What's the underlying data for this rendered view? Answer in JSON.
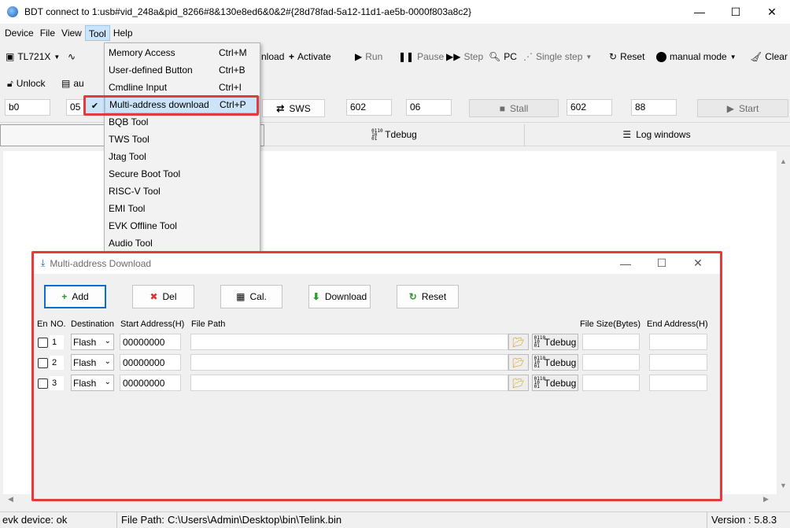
{
  "window": {
    "title": "BDT connect to 1:usb#vid_248a&pid_8266#8&130e8ed6&0&2#{28d78fad-5a12-11d1-ae5b-0000f803a8c2}",
    "controls": [
      "—",
      "☐",
      "✕"
    ]
  },
  "menubar": [
    "Device",
    "File",
    "View",
    "Tool",
    "Help"
  ],
  "toolbar1": {
    "chip": "TL721X",
    "download": "nload",
    "activate": "Activate",
    "run": "Run",
    "pause": "Pause",
    "step": "Step",
    "pc": "PC",
    "single_step": "Single step",
    "reset": "Reset",
    "manual_mode": "manual mode",
    "clear": "Clear"
  },
  "toolbar2": {
    "unlock": "Unlock",
    "auto": "au"
  },
  "fields": {
    "f1": "b0",
    "f2": "05",
    "sws": "SWS",
    "f3": "602",
    "f4": "06",
    "stall": "Stall",
    "f5": "602",
    "f6": "88",
    "start": "Start"
  },
  "tabs": {
    "tdebug": "Tdebug",
    "log": "Log windows"
  },
  "tool_menu": [
    {
      "label": "Memory Access",
      "shortcut": "Ctrl+M"
    },
    {
      "label": "User-defined Button",
      "shortcut": "Ctrl+B"
    },
    {
      "label": "Cmdline Input",
      "shortcut": "Ctrl+I"
    },
    {
      "label": "Multi-address download",
      "shortcut": "Ctrl+P",
      "checked": true
    },
    {
      "label": "BQB Tool",
      "shortcut": ""
    },
    {
      "label": "TWS Tool",
      "shortcut": ""
    },
    {
      "label": "Jtag Tool",
      "shortcut": ""
    },
    {
      "label": "Secure Boot Tool",
      "shortcut": ""
    },
    {
      "label": "RISC-V Tool",
      "shortcut": ""
    },
    {
      "label": "EMI Tool",
      "shortcut": ""
    },
    {
      "label": "EVK Offline Tool",
      "shortcut": ""
    },
    {
      "label": "Audio Tool",
      "shortcut": ""
    }
  ],
  "dialog": {
    "title": "Multi-address Download",
    "buttons": {
      "add": "Add",
      "del": "Del",
      "cal": "Cal.",
      "download": "Download",
      "reset": "Reset"
    },
    "headers": {
      "en": "En",
      "no": "NO.",
      "destination": "Destination",
      "start": "Start Address(H)",
      "path": "File Path",
      "size": "File Size(Bytes)",
      "end": "End Address(H)"
    },
    "rows": [
      {
        "no": "1",
        "destination": "Flash",
        "start": "00000000",
        "path": "",
        "tdebug": "Tdebug"
      },
      {
        "no": "2",
        "destination": "Flash",
        "start": "00000000",
        "path": "",
        "tdebug": "Tdebug"
      },
      {
        "no": "3",
        "destination": "Flash",
        "start": "00000000",
        "path": "",
        "tdebug": "Tdebug"
      }
    ]
  },
  "statusbar": {
    "device": "evk device: ok",
    "filepath_label": "File Path:",
    "filepath": "C:\\Users\\Admin\\Desktop\\bin\\Telink.bin",
    "version": "Version : 5.8.3"
  },
  "colors": {
    "highlight": "#e53a3a",
    "selection": "#cce4f7"
  }
}
